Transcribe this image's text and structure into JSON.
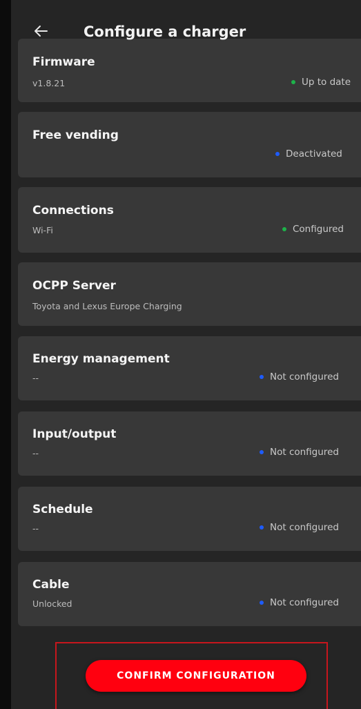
{
  "header": {
    "title": "Configure a charger",
    "back_icon": "arrow-left-icon"
  },
  "colors": {
    "background": "#252525",
    "card": "#383838",
    "status_green": "#1db34a",
    "status_blue": "#1e5cff",
    "accent_red": "#ff000f"
  },
  "items": [
    {
      "title": "Firmware",
      "subtitle": "v1.8.21",
      "status": "Up to date",
      "status_color": "green"
    },
    {
      "title": "Free vending",
      "subtitle": "",
      "status": "Deactivated",
      "status_color": "blue"
    },
    {
      "title": "Connections",
      "subtitle": "Wi-Fi",
      "status": "Configured",
      "status_color": "green"
    },
    {
      "title": "OCPP Server",
      "subtitle": "Toyota and Lexus Europe Charging",
      "status": "",
      "status_color": ""
    },
    {
      "title": "Energy management",
      "subtitle": "--",
      "status": "Not configured",
      "status_color": "blue"
    },
    {
      "title": "Input/output",
      "subtitle": "--",
      "status": "Not configured",
      "status_color": "blue"
    },
    {
      "title": "Schedule",
      "subtitle": "--",
      "status": "Not configured",
      "status_color": "blue"
    },
    {
      "title": "Cable",
      "subtitle": "Unlocked",
      "status": "Not configured",
      "status_color": "blue"
    }
  ],
  "footer": {
    "confirm_label": "CONFIRM CONFIGURATION"
  }
}
